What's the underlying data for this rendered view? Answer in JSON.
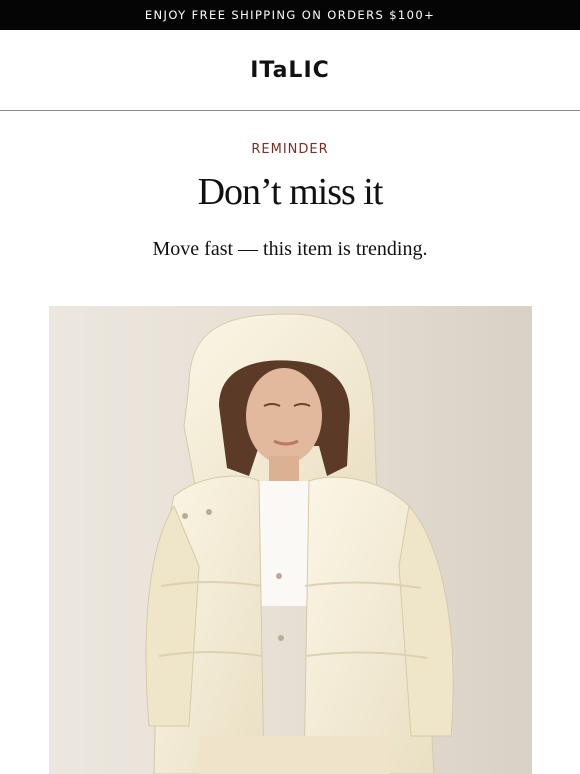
{
  "promo_bar": {
    "text": "ENJOY FREE SHIPPING ON ORDERS  $100+"
  },
  "header": {
    "logo_text": "ITaLIC"
  },
  "content": {
    "eyebrow": "REMINDER",
    "headline": "Don’t miss it",
    "subhead": "Move fast — this item is trending."
  },
  "hero": {
    "subject": "woman-in-cream-puffer-jacket"
  },
  "colors": {
    "promo_bg": "#050505",
    "eyebrow": "#7a2f24",
    "photo_bg": "#e7e1d8",
    "jacket": "#f3ecd6"
  }
}
